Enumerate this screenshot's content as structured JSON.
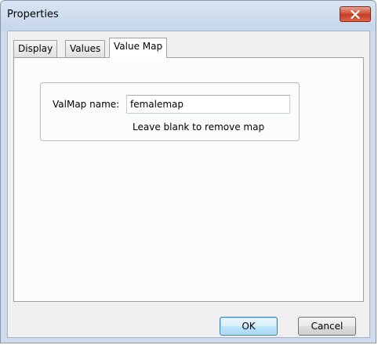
{
  "window": {
    "title": "Properties"
  },
  "tabs": [
    {
      "label": "Display"
    },
    {
      "label": "Values"
    },
    {
      "label": "Value Map",
      "active": true
    }
  ],
  "valuemap": {
    "name_label": "ValMap name:",
    "name_value": "femalemap",
    "hint": "Leave blank to remove map"
  },
  "buttons": {
    "ok_label": "OK",
    "cancel_label": "Cancel"
  },
  "colors": {
    "title_bar": "#c6d6ea",
    "close_button": "#c23a21",
    "dialog_face": "#f0f0f0",
    "default_button_border": "#3c7fb1"
  },
  "icons": {
    "close": "close-icon"
  }
}
